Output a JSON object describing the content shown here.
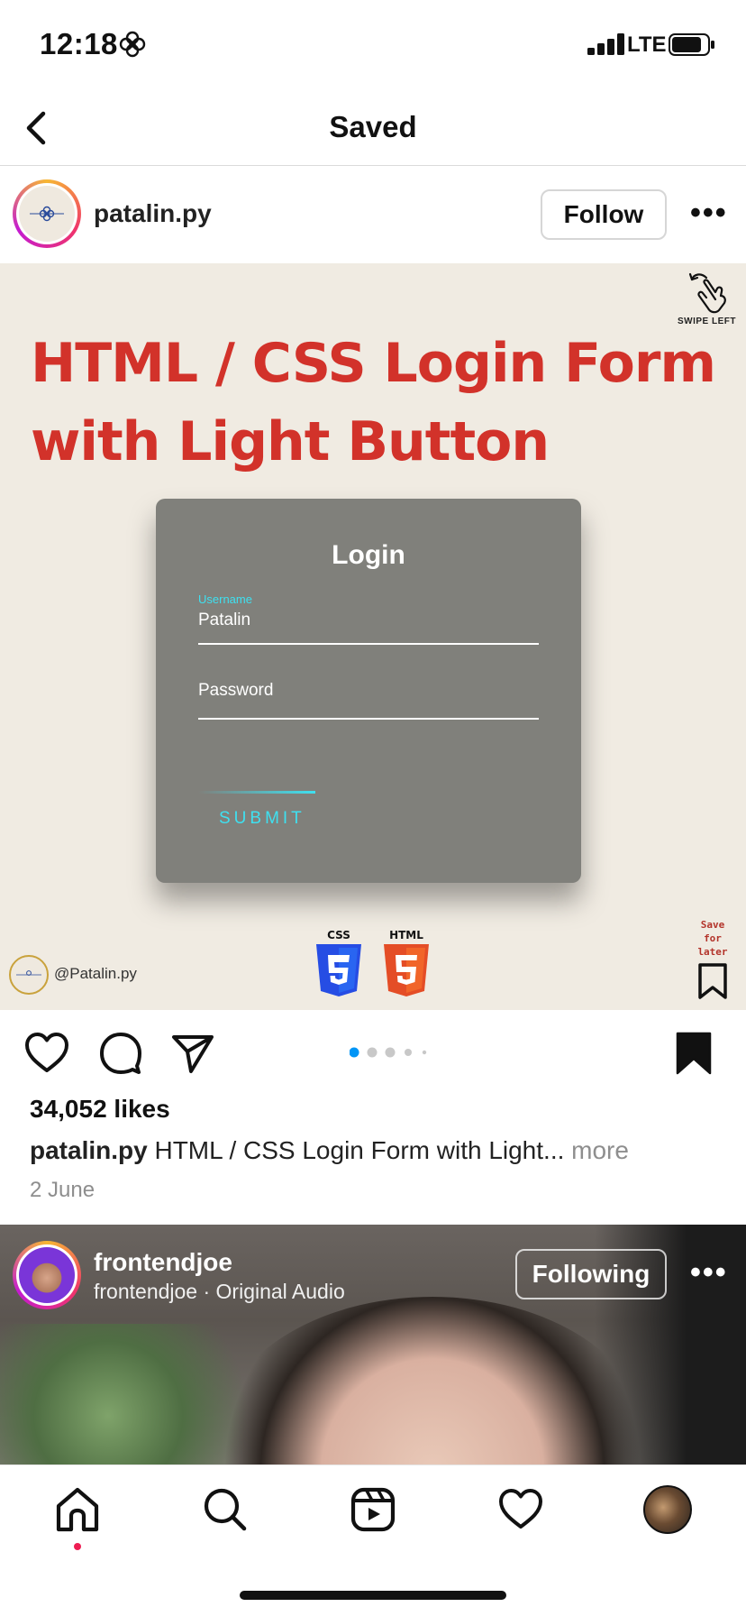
{
  "status_bar": {
    "time": "12:18",
    "network": "LTE"
  },
  "nav": {
    "title": "Saved"
  },
  "post": {
    "username": "patalin.py",
    "follow_label": "Follow",
    "more_label": "•••",
    "image": {
      "swipe_label": "SWIPE LEFT",
      "headline_line1": "HTML / CSS Login Form",
      "headline_line2": "with Light Button",
      "login_title": "Login",
      "username_label": "Username",
      "username_value": "Patalin",
      "password_label": "Password",
      "submit_label": "SUBMIT",
      "handle": "@Patalin.py",
      "css_label": "CSS",
      "html_label": "HTML",
      "save_line1": "Save",
      "save_line2": "for",
      "save_line3": "later"
    },
    "carousel": {
      "count": 5,
      "active_index": 0
    },
    "likes": "34,052 likes",
    "caption_user": "patalin.py",
    "caption_text": "HTML / CSS Login Form with Light...",
    "caption_more": "more",
    "date": "2 June"
  },
  "reel": {
    "username": "frontendjoe",
    "audio": "frontendjoe · Original Audio",
    "following_label": "Following",
    "more_label": "•••"
  },
  "tab_bar": {
    "items": [
      "home-icon",
      "search-icon",
      "reels-icon",
      "activity-icon",
      "profile-avatar"
    ],
    "active": "home-icon"
  },
  "colors": {
    "accent_red": "#d2322a",
    "link_blue": "#0095f6",
    "cyan": "#3ee0f0"
  }
}
